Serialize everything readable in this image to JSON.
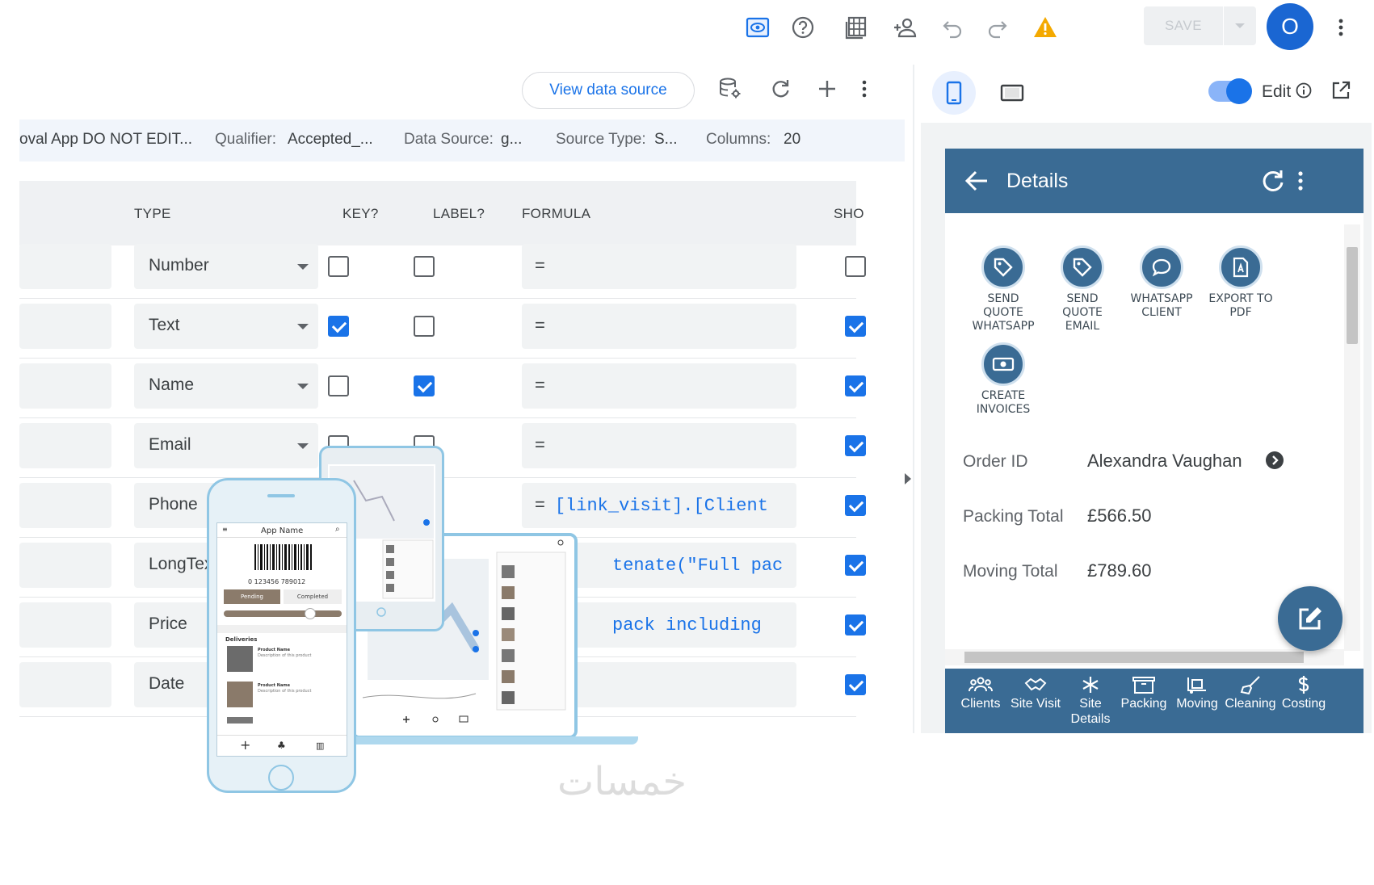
{
  "toolbar": {
    "save_label": "SAVE",
    "avatar_initial": "O",
    "icons": [
      "preview-icon",
      "help-icon",
      "spreadsheet-icon",
      "add-person-icon",
      "undo-icon",
      "redo-icon",
      "warning-icon",
      "chevron-down-icon",
      "more-vert-icon"
    ]
  },
  "data_panel": {
    "view_data_source": "View data source",
    "meta": {
      "table_name": "oval App DO NOT EDIT...",
      "qualifier_label": "Qualifier:",
      "qualifier_value": "Accepted_...",
      "data_source_label": "Data Source:",
      "data_source_value": "g...",
      "source_type_label": "Source Type:",
      "source_type_value": "S...",
      "columns_label": "Columns:",
      "columns_value": "20"
    },
    "headers": {
      "type": "TYPE",
      "key": "KEY?",
      "label": "LABEL?",
      "formula": "FORMULA",
      "show": "SHO"
    },
    "rows": [
      {
        "type": "Number",
        "key": false,
        "label": false,
        "formula_prefix": "=",
        "formula_code": "",
        "show": false
      },
      {
        "type": "Text",
        "key": true,
        "label": false,
        "formula_prefix": "=",
        "formula_code": "",
        "show": true
      },
      {
        "type": "Name",
        "key": false,
        "label": true,
        "formula_prefix": "=",
        "formula_code": "",
        "show": true
      },
      {
        "type": "Email",
        "key": false,
        "label": false,
        "formula_prefix": "=",
        "formula_code": "",
        "show": true
      },
      {
        "type": "Phone",
        "key": false,
        "label": false,
        "formula_prefix": "=",
        "formula_code": "[link_visit].[Client",
        "show": true
      },
      {
        "type": "LongText",
        "key": false,
        "label": false,
        "formula_prefix": "",
        "formula_code": "tenate(\"Full pac",
        "show": true
      },
      {
        "type": "Price",
        "key": false,
        "label": false,
        "formula_prefix": "",
        "formula_code": "pack including",
        "show": true
      },
      {
        "type": "Date",
        "key": false,
        "label": false,
        "formula_prefix": "",
        "formula_code": "",
        "show": true
      }
    ]
  },
  "preview": {
    "edit_label": "Edit",
    "app_title": "Details",
    "actions": [
      {
        "label1": "SEND",
        "label2": "QUOTE",
        "label3": "WHATSAPP"
      },
      {
        "label1": "SEND",
        "label2": "QUOTE",
        "label3": "EMAIL"
      },
      {
        "label1": "WHATSAPP",
        "label2": "CLIENT",
        "label3": ""
      },
      {
        "label1": "EXPORT TO",
        "label2": "PDF",
        "label3": ""
      },
      {
        "label1": "CREATE",
        "label2": "INVOICES",
        "label3": ""
      }
    ],
    "fields": [
      {
        "label": "Order ID",
        "value": "Alexandra Vaughan"
      },
      {
        "label": "Packing Total",
        "value": "£566.50"
      },
      {
        "label": "Moving Total",
        "value": "£789.60"
      }
    ],
    "nav": [
      {
        "label1": "Clients",
        "label2": ""
      },
      {
        "label1": "Site Visit",
        "label2": ""
      },
      {
        "label1": "Site",
        "label2": "Details"
      },
      {
        "label1": "Packing",
        "label2": ""
      },
      {
        "label1": "Moving",
        "label2": ""
      },
      {
        "label1": "Cleaning",
        "label2": ""
      },
      {
        "label1": "Costing",
        "label2": ""
      }
    ]
  },
  "illustration": {
    "app_name": "App Name",
    "barcode_number": "0 123456 789012",
    "tab_pending": "Pending",
    "tab_completed": "Completed",
    "section_title": "Deliveries",
    "product_name": "Product Name",
    "product_desc": "Description of this product"
  },
  "watermark": "خمسات",
  "colors": {
    "accent": "#1a73e8",
    "app_primary": "#3a6b94",
    "warning": "#f4a900"
  }
}
